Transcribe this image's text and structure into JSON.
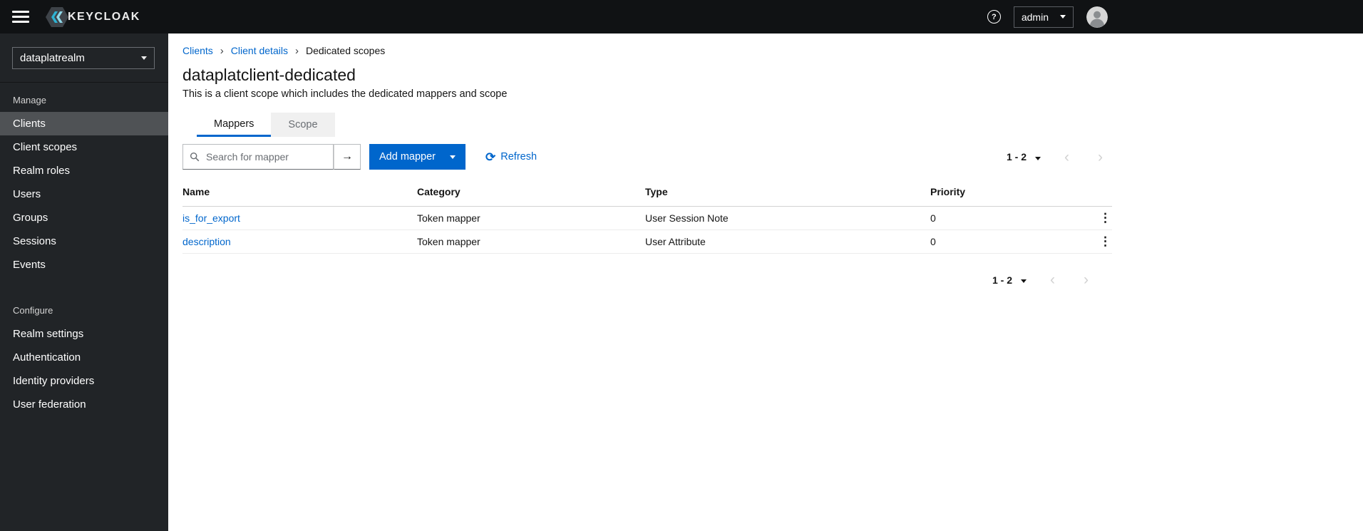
{
  "colors": {
    "accent_blue": "#0066cc",
    "topbar_bg": "#101214",
    "sidebar_bg": "#212427",
    "active_nav_bg": "#4f5255",
    "inactive_tab_bg": "#f0f0f0"
  },
  "icons": {
    "hamburger": "css-bars",
    "help": "?",
    "caret_down": "css-triangle",
    "search": "svg-magnifier",
    "search_submit": "→",
    "refresh": "⟳",
    "breadcrumb_separator": "›",
    "pagination_prev": "‹",
    "pagination_next": "›",
    "kebab": "⋮",
    "avatar": "svg-person"
  },
  "topbar": {
    "brand": "KEYCLOAK",
    "user_menu": {
      "label": "admin"
    }
  },
  "sidebar": {
    "realm_selector": {
      "value": "dataplatrealm"
    },
    "sections": [
      {
        "title": "Manage",
        "items": [
          {
            "label": "Clients",
            "active": true
          },
          {
            "label": "Client scopes",
            "active": false
          },
          {
            "label": "Realm roles",
            "active": false
          },
          {
            "label": "Users",
            "active": false
          },
          {
            "label": "Groups",
            "active": false
          },
          {
            "label": "Sessions",
            "active": false
          },
          {
            "label": "Events",
            "active": false
          }
        ]
      },
      {
        "title": "Configure",
        "items": [
          {
            "label": "Realm settings",
            "active": false
          },
          {
            "label": "Authentication",
            "active": false
          },
          {
            "label": "Identity providers",
            "active": false
          },
          {
            "label": "User federation",
            "active": false
          }
        ]
      }
    ]
  },
  "breadcrumb": {
    "items": [
      {
        "label": "Clients",
        "link": true
      },
      {
        "label": "Client details",
        "link": true
      },
      {
        "label": "Dedicated scopes",
        "link": false
      }
    ]
  },
  "page": {
    "title": "dataplatclient-dedicated",
    "subtitle": "This is a client scope which includes the dedicated mappers and scope"
  },
  "tabs": [
    {
      "label": "Mappers",
      "active": true
    },
    {
      "label": "Scope",
      "active": false
    }
  ],
  "toolbar": {
    "search": {
      "placeholder": "Search for mapper"
    },
    "add_button": {
      "label": "Add mapper"
    },
    "refresh_label": "Refresh",
    "pagination": {
      "range": "1 - 2"
    }
  },
  "table": {
    "columns": [
      "Name",
      "Category",
      "Type",
      "Priority"
    ],
    "rows": [
      {
        "name": "is_for_export",
        "category": "Token mapper",
        "type": "User Session Note",
        "priority": "0"
      },
      {
        "name": "description",
        "category": "Token mapper",
        "type": "User Attribute",
        "priority": "0"
      }
    ]
  }
}
